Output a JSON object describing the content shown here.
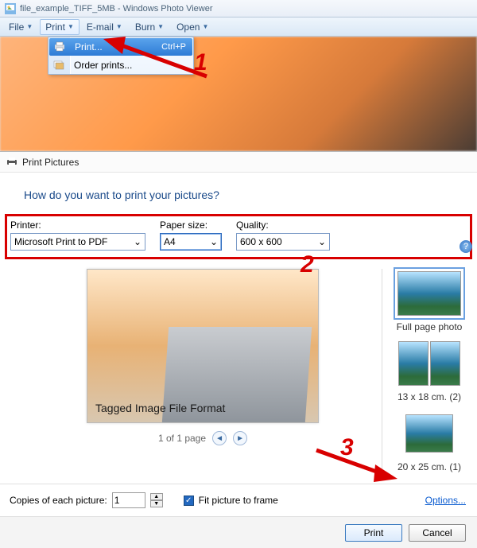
{
  "wpv": {
    "filename": "file_example_TIFF_5MB - Windows Photo Viewer",
    "menu": {
      "file": "File",
      "print": "Print",
      "email": "E-mail",
      "burn": "Burn",
      "open": "Open"
    },
    "printmenu": {
      "print": "Print...",
      "print_kbd": "Ctrl+P",
      "order": "Order prints..."
    }
  },
  "dlg": {
    "title": "Print Pictures",
    "heading": "How do you want to print your pictures?",
    "printer_lbl": "Printer:",
    "paper_lbl": "Paper size:",
    "quality_lbl": "Quality:",
    "printer_val": "Microsoft Print to PDF",
    "paper_val": "A4",
    "quality_val": "600 x 600",
    "preview_caption": "Tagged Image File Format",
    "pager": "1 of 1 page",
    "layouts": {
      "full": "Full page photo",
      "l13": "13 x 18 cm. (2)",
      "l20": "20 x 25 cm. (1)"
    },
    "copies_lbl": "Copies of each picture:",
    "copies_val": "1",
    "fit_lbl": "Fit picture to frame",
    "options": "Options...",
    "print_btn": "Print",
    "cancel_btn": "Cancel"
  },
  "markers": {
    "m1": "1",
    "m2": "2",
    "m3": "3"
  }
}
